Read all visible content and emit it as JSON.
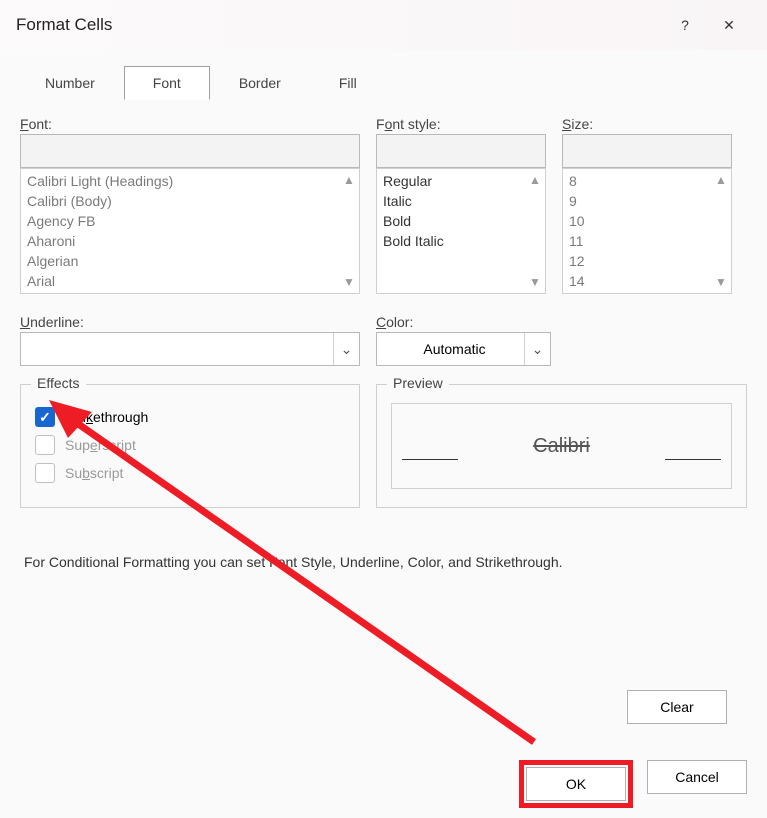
{
  "title": "Format Cells",
  "help_symbol": "?",
  "close_symbol": "✕",
  "tabs": [
    "Number",
    "Font",
    "Border",
    "Fill"
  ],
  "active_tab": 1,
  "font": {
    "label": "Font:",
    "value": "",
    "items": [
      "Calibri Light (Headings)",
      "Calibri (Body)",
      "Agency FB",
      "Aharoni",
      "Algerian",
      "Arial"
    ]
  },
  "fontstyle": {
    "label_pre": "F",
    "label_u": "o",
    "label_post": "nt style:",
    "value": "",
    "items": [
      "Regular",
      "Italic",
      "Bold",
      "Bold Italic"
    ]
  },
  "size": {
    "label_pre": "",
    "label_u": "S",
    "label_post": "ize:",
    "value": "",
    "items": [
      "8",
      "9",
      "10",
      "11",
      "12",
      "14"
    ]
  },
  "underline": {
    "label_u": "U",
    "label_post": "nderline:",
    "value": ""
  },
  "color": {
    "label_u": "C",
    "label_post": "olor:",
    "value": "Automatic"
  },
  "effects": {
    "legend": "Effects",
    "strikethrough": {
      "label_pre": "Stri",
      "label_u": "k",
      "label_post": "ethrough",
      "checked": true
    },
    "superscript": {
      "label_pre": "Sup",
      "label_u": "e",
      "label_post": "rscript",
      "disabled": true
    },
    "subscript": {
      "label_pre": "Su",
      "label_u": "b",
      "label_post": "script",
      "disabled": true
    }
  },
  "preview": {
    "legend": "Preview",
    "text": "Calibri"
  },
  "note": "For Conditional Formatting you can set Font Style, Underline, Color, and Strikethrough.",
  "buttons": {
    "clear": "Clear",
    "ok": "OK",
    "cancel": "Cancel"
  },
  "scroll_up": "▲",
  "scroll_down": "▼",
  "dropdown_arrow": "⌄",
  "check_mark": "✓"
}
